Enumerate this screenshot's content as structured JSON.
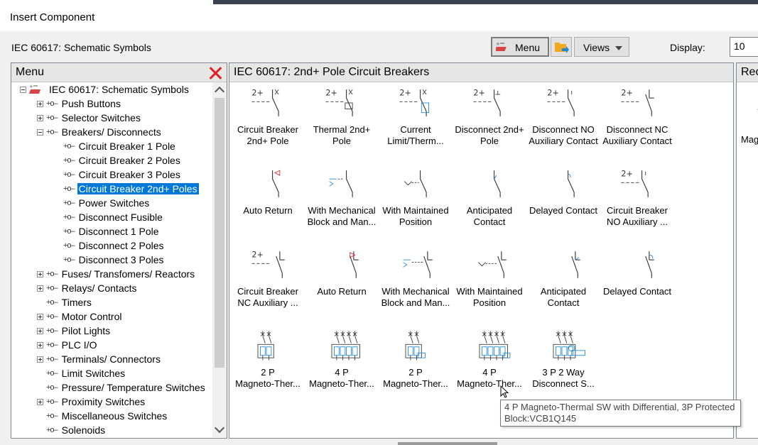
{
  "window": {
    "title": "Insert Component"
  },
  "header": {
    "library_name": "IEC 60617: Schematic Symbols",
    "menu_button": "Menu",
    "views_button": "Views",
    "display_label": "Display:",
    "display_value": "10"
  },
  "menu_panel": {
    "title": "Menu",
    "tree": [
      {
        "label": "IEC 60617: Schematic Symbols",
        "level": 0,
        "expander": "minus"
      },
      {
        "label": "Push Buttons",
        "level": 1,
        "expander": "plus"
      },
      {
        "label": "Selector Switches",
        "level": 1,
        "expander": "plus"
      },
      {
        "label": "Breakers/ Disconnects",
        "level": 1,
        "expander": "minus"
      },
      {
        "label": "Circuit Breaker 1 Pole",
        "level": 2,
        "expander": "none"
      },
      {
        "label": "Circuit Breaker 2 Poles",
        "level": 2,
        "expander": "none"
      },
      {
        "label": "Circuit Breaker 3 Poles",
        "level": 2,
        "expander": "none"
      },
      {
        "label": "Circuit Breaker 2nd+ Poles",
        "level": 2,
        "expander": "none",
        "selected": true
      },
      {
        "label": "Power Switches",
        "level": 2,
        "expander": "none"
      },
      {
        "label": "Disconnect Fusible",
        "level": 2,
        "expander": "none"
      },
      {
        "label": "Disconnect 1 Pole",
        "level": 2,
        "expander": "none"
      },
      {
        "label": "Disconnect 2 Poles",
        "level": 2,
        "expander": "none"
      },
      {
        "label": "Disconnect 3 Poles",
        "level": 2,
        "expander": "none"
      },
      {
        "label": "Fuses/ Transfomers/ Reactors",
        "level": 1,
        "expander": "plus"
      },
      {
        "label": "Relays/ Contacts",
        "level": 1,
        "expander": "plus"
      },
      {
        "label": "Timers",
        "level": 1,
        "expander": "none"
      },
      {
        "label": "Motor Control",
        "level": 1,
        "expander": "plus"
      },
      {
        "label": "Pilot Lights",
        "level": 1,
        "expander": "plus"
      },
      {
        "label": "PLC I/O",
        "level": 1,
        "expander": "plus"
      },
      {
        "label": "Terminals/ Connectors",
        "level": 1,
        "expander": "plus"
      },
      {
        "label": "Limit Switches",
        "level": 1,
        "expander": "none"
      },
      {
        "label": "Pressure/ Temperature Switches",
        "level": 1,
        "expander": "none"
      },
      {
        "label": "Proximity Switches",
        "level": 1,
        "expander": "plus"
      },
      {
        "label": "Miscellaneous Switches",
        "level": 1,
        "expander": "none"
      },
      {
        "label": "Solenoids",
        "level": 1,
        "expander": "none"
      }
    ]
  },
  "components_panel": {
    "title": "IEC 60617: 2nd+ Pole Circuit Breakers",
    "items": [
      {
        "line1": "Circuit Breaker",
        "line2": "2nd+ Pole",
        "symbol": "breaker-2plus"
      },
      {
        "line1": "Thermal 2nd+",
        "line2": "Pole",
        "symbol": "thermal"
      },
      {
        "line1": "Current",
        "line2": "Limit/Therm...",
        "symbol": "current-limit"
      },
      {
        "line1": "Disconnect 2nd+",
        "line2": "Pole",
        "symbol": "disconnect"
      },
      {
        "line1": "Disconnect NO",
        "line2": "Auxiliary Contact",
        "symbol": "disconnect-no"
      },
      {
        "line1": "Disconnect NC",
        "line2": "Auxiliary Contact",
        "symbol": "disconnect-nc"
      },
      {
        "line1": "Auto Return",
        "line2": "",
        "symbol": "auto-return"
      },
      {
        "line1": "With Mechanical",
        "line2": "Block and Man...",
        "symbol": "mech-block"
      },
      {
        "line1": "With Maintained",
        "line2": "Position",
        "symbol": "maintained"
      },
      {
        "line1": "Anticipated",
        "line2": "Contact",
        "symbol": "anticipated"
      },
      {
        "line1": "Delayed Contact",
        "line2": "",
        "symbol": "delayed"
      },
      {
        "line1": "Circuit Breaker",
        "line2": "NO Auxiliary ...",
        "symbol": "breaker-no-aux"
      },
      {
        "line1": "Circuit Breaker",
        "line2": "NC Auxiliary ...",
        "symbol": "breaker-nc-aux"
      },
      {
        "line1": "Auto Return",
        "line2": "",
        "symbol": "auto-return-nc"
      },
      {
        "line1": "With Mechanical",
        "line2": "Block and Man...",
        "symbol": "mech-block-nc"
      },
      {
        "line1": "With Maintained",
        "line2": "Position",
        "symbol": "maintained-nc"
      },
      {
        "line1": "Anticipated",
        "line2": "Contact",
        "symbol": "anticipated-nc"
      },
      {
        "line1": "Delayed Contact",
        "line2": "",
        "symbol": "delayed-nc"
      },
      {
        "line1": "2 P",
        "line2": "Magneto-Ther...",
        "symbol": "mt-2p"
      },
      {
        "line1": "4 P",
        "line2": "Magneto-Ther...",
        "symbol": "mt-4p"
      },
      {
        "line1": "2 P",
        "line2": "Magneto-Ther...",
        "symbol": "mt-2p-diff"
      },
      {
        "line1": "4 P",
        "line2": "Magneto-Ther...",
        "symbol": "mt-4p-diff"
      },
      {
        "line1": "3 P 2 Way",
        "line2": "Disconnect S...",
        "symbol": "3p-2way"
      }
    ]
  },
  "recent_panel": {
    "title": "Rec",
    "item_label": "Mag"
  },
  "tooltip": {
    "line1": "4 P Magneto-Thermal SW with Differential, 3P Protected",
    "line2": "Block:VCB1Q145"
  },
  "colors": {
    "selection": "#0078d7",
    "close": "#e02020",
    "symbol_accent": "#1e88d6",
    "symbol_red": "#d62020"
  }
}
